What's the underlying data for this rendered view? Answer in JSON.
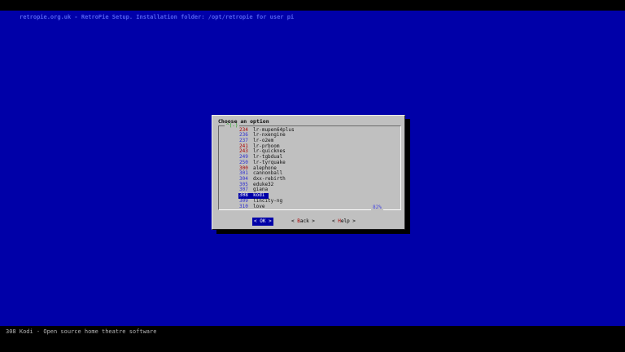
{
  "screen": {
    "backtitle": "retropie.org.uk - RetroPie Setup. Installation folder: /opt/retropie for user pi",
    "statusline": "308 Kodi - Open source home theatre software"
  },
  "dialog": {
    "title": "Choose an option",
    "scroll_up_indicator": "^(-)",
    "scroll_percent": "82%",
    "menu_items": [
      {
        "tag": "234",
        "item": "lr-mupen64plus",
        "tag_color": "#aa0000",
        "selected": false
      },
      {
        "tag": "236",
        "item": "lr-nxengine",
        "tag_color": "#2d2dd0",
        "selected": false
      },
      {
        "tag": "237",
        "item": "lr-o2em",
        "tag_color": "#2d2dd0",
        "selected": false
      },
      {
        "tag": "241",
        "item": "lr-prboom",
        "tag_color": "#aa0000",
        "selected": false
      },
      {
        "tag": "243",
        "item": "lr-quicknes",
        "tag_color": "#aa0000",
        "selected": false
      },
      {
        "tag": "249",
        "item": "lr-tgbdual",
        "tag_color": "#2d2dd0",
        "selected": false
      },
      {
        "tag": "250",
        "item": "lr-tyrquake",
        "tag_color": "#2d2dd0",
        "selected": false
      },
      {
        "tag": "300",
        "item": "alephone",
        "tag_color": "#aa0000",
        "selected": false
      },
      {
        "tag": "301",
        "item": "cannonball",
        "tag_color": "#2d2dd0",
        "selected": false
      },
      {
        "tag": "304",
        "item": "dxx-rebirth",
        "tag_color": "#2d2dd0",
        "selected": false
      },
      {
        "tag": "305",
        "item": "eduke32",
        "tag_color": "#2d2dd0",
        "selected": false
      },
      {
        "tag": "307",
        "item": "giana",
        "tag_color": "#2d2dd0",
        "selected": false
      },
      {
        "tag": "308",
        "item": "kodi",
        "tag_color": "#ffffff",
        "selected": true
      },
      {
        "tag": "309",
        "item": "lincity-ng",
        "tag_color": "#2d2dd0",
        "selected": false
      },
      {
        "tag": "310",
        "item": "love",
        "tag_color": "#2d2dd0",
        "selected": false
      }
    ],
    "buttons": [
      {
        "name": "ok",
        "pre": "< ",
        "key": "O",
        "post": "K >",
        "active": true
      },
      {
        "name": "back",
        "pre": "< ",
        "key": "B",
        "post": "ack >",
        "active": false
      },
      {
        "name": "help",
        "pre": "< ",
        "key": "H",
        "post": "elp >",
        "active": false
      }
    ]
  },
  "colors": {
    "screen_bg": "#0000a8",
    "backtitle_text": "#5561f0",
    "dialog_bg": "#c0c0c0",
    "selected_bg": "#0000a8",
    "tag_red": "#aa0000",
    "tag_blue": "#2d2dd0",
    "scroll_indicator_green": "#18a018",
    "scroll_percent_blue": "#4545e0",
    "hotkey_red": "#aa0000"
  }
}
